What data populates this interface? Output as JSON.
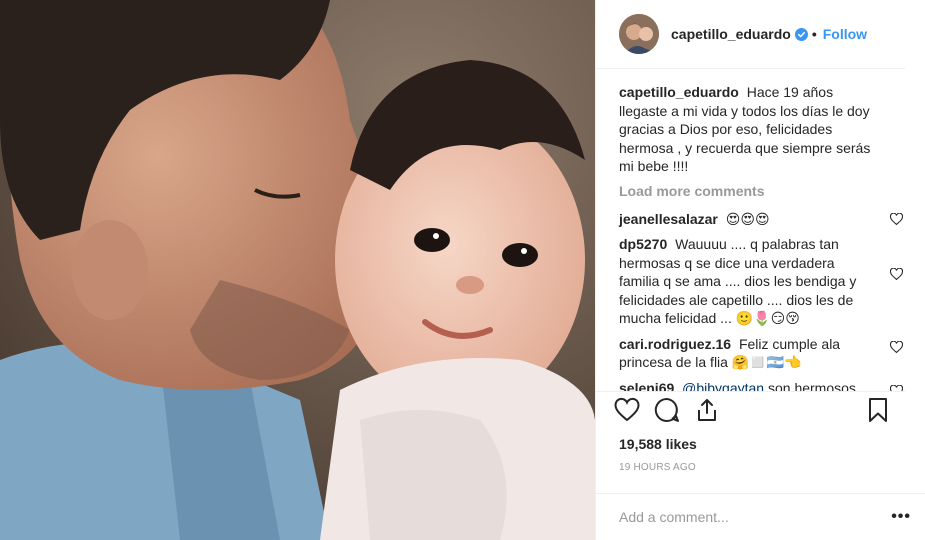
{
  "post": {
    "photo_description_icon": "photo-father-kissing-baby",
    "header": {
      "username": "capetillo_eduardo",
      "verified": true,
      "separator": "•",
      "follow_label": "Follow"
    },
    "caption": {
      "username": "capetillo_eduardo",
      "text": "Hace 19 años llegaste a mi vida y todos los días le doy gracias a Dios por eso, felicidades hermosa , y recuerda que siempre serás mi bebe !!!!"
    },
    "load_more_label": "Load more comments",
    "comments": [
      {
        "username": "jeanellesalazar",
        "text": "",
        "emojis": "😍😍😍"
      },
      {
        "username": "dp5270",
        "text": "Wauuuu .... q palabras tan hermosas q se dice una verdadera familia q se ama .... dios les bendiga y felicidades ale capetillo .... dios les de mucha felicidad ...",
        "emojis": "🙂🌷😏😚"
      },
      {
        "username": "cari.rodriguez.16",
        "text": "Feliz cumple ala princesa de la flia",
        "emojis": "🤗◻️🇦🇷👈"
      },
      {
        "username": "seleni69",
        "mention": "@bibygaytan",
        "text": "son hermosos tus hijos",
        "emojis": "😍"
      }
    ],
    "likes_label": "19,588 likes",
    "time_label": "19 HOURS AGO",
    "add_comment_placeholder": "Add a comment...",
    "more_label": "•••",
    "colors": {
      "link": "#3897f0",
      "muted": "#999999",
      "border": "#efefef"
    }
  }
}
